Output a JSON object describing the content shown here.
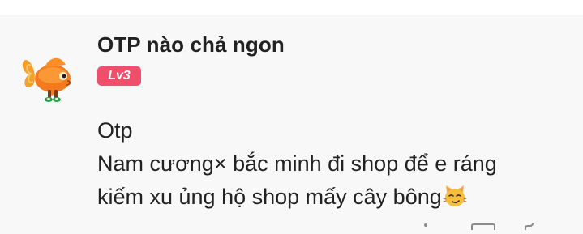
{
  "comment": {
    "username": "OTP nào chả ngon",
    "level": "Lv3",
    "avatar": "goldfish-avatar",
    "body": {
      "line1": "Otp",
      "line2": "Nam cương× bắc minh đi shop để e ráng",
      "line3": "kiếm xu ủng hộ shop mấy cây bông",
      "emoji": "smirking-cat-emoji"
    }
  },
  "actions": {
    "icons": [
      "more-icon",
      "reply-icon",
      "like-icon"
    ]
  },
  "colors": {
    "background": "#f8f8f8",
    "level_badge": "#ef4f6b",
    "text": "#222222"
  }
}
